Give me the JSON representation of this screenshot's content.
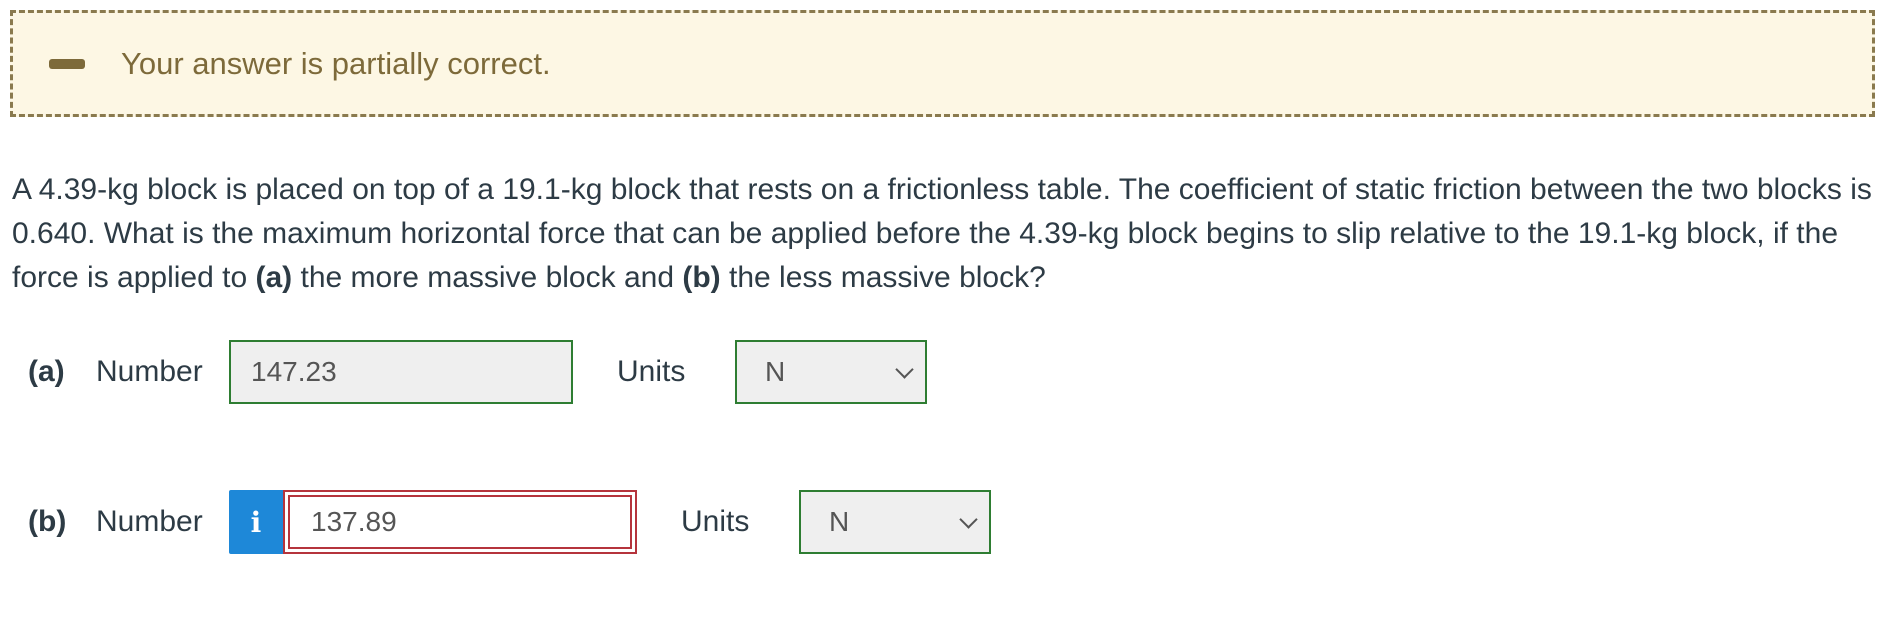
{
  "feedback": {
    "icon": "minus-icon",
    "message": "Your answer is partially correct.",
    "colors": {
      "background": "#fdf7e4",
      "border": "#8a7a4e",
      "text": "#7d6a3a"
    }
  },
  "question": {
    "text_1": "A 4.39-kg block is placed on top of a 19.1-kg block that rests on a frictionless table. The coefficient of static friction between the two blocks is 0.640. What is the maximum horizontal force that can be applied before the 4.39-kg block begins to slip relative to the 19.1-kg block, if the force is applied to ",
    "part_a_marker": "(a)",
    "text_2": " the more massive block and ",
    "part_b_marker": "(b)",
    "text_3": " the less massive block?"
  },
  "answers": [
    {
      "part": "(a)",
      "number_label": "Number",
      "value": "147.23",
      "status": "correct",
      "units_label": "Units",
      "units_value": "N"
    },
    {
      "part": "(b)",
      "number_label": "Number",
      "info_icon": "i",
      "value": "137.89",
      "status": "incorrect",
      "units_label": "Units",
      "units_value": "N"
    }
  ],
  "colors": {
    "correct": "#2e7d32",
    "incorrect": "#b5343c",
    "info": "#1e88d8"
  }
}
